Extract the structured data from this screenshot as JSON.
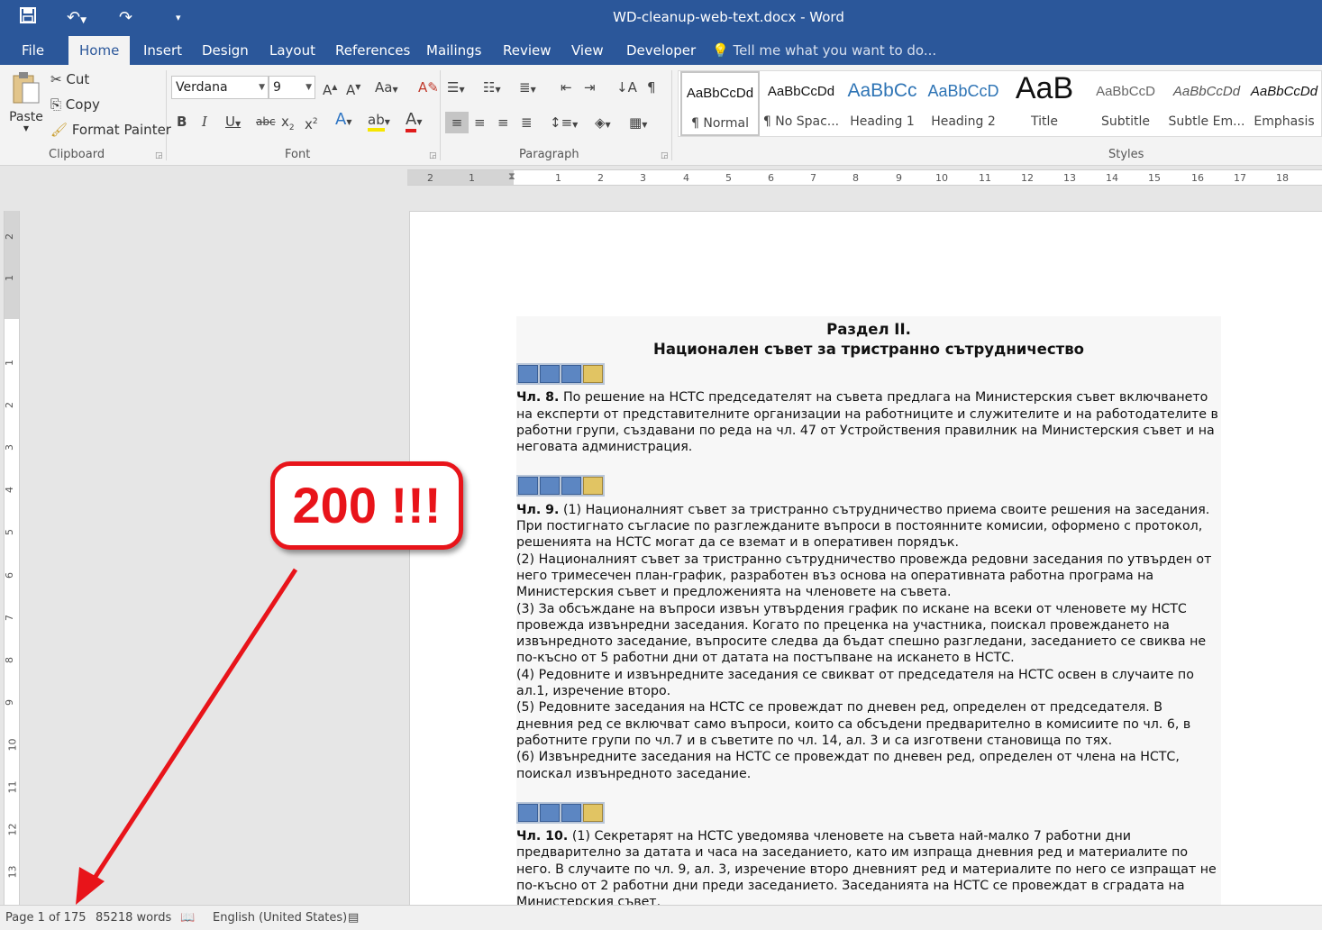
{
  "window": {
    "title": "WD-cleanup-web-text.docx - Word"
  },
  "quick_access": {
    "save_icon": "save-icon",
    "undo_icon": "undo-icon",
    "redo_icon": "redo-icon",
    "customize_icon": "customize-qat-icon"
  },
  "tabs": [
    {
      "label": "File"
    },
    {
      "label": "Home"
    },
    {
      "label": "Insert"
    },
    {
      "label": "Design"
    },
    {
      "label": "Layout"
    },
    {
      "label": "References"
    },
    {
      "label": "Mailings"
    },
    {
      "label": "Review"
    },
    {
      "label": "View"
    },
    {
      "label": "Developer"
    }
  ],
  "tell_me": "Tell me what you want to do...",
  "clipboard": {
    "paste": "Paste",
    "cut": "Cut",
    "copy": "Copy",
    "format_painter": "Format Painter",
    "label": "Clipboard"
  },
  "font": {
    "family": "Verdana",
    "size": "9",
    "label": "Font"
  },
  "paragraph": {
    "label": "Paragraph"
  },
  "styles": {
    "label": "Styles",
    "items": [
      {
        "sample": "AaBbCcDd",
        "name": "¶ Normal"
      },
      {
        "sample": "AaBbCcDd",
        "name": "¶ No Spac..."
      },
      {
        "sample": "AaBbCc",
        "name": "Heading 1"
      },
      {
        "sample": "AaBbCcD",
        "name": "Heading 2"
      },
      {
        "sample": "AaB",
        "name": "Title"
      },
      {
        "sample": "AaBbCcD",
        "name": "Subtitle"
      },
      {
        "sample": "AaBbCcDd",
        "name": "Subtle Em..."
      },
      {
        "sample": "AaBbCcDd",
        "name": "Emphasis"
      }
    ]
  },
  "ruler": {
    "h_ticks": [
      "2",
      "1",
      "1",
      "2",
      "3",
      "4",
      "5",
      "6",
      "7",
      "8",
      "9",
      "10",
      "11",
      "12",
      "13",
      "14",
      "15",
      "16",
      "17",
      "18"
    ],
    "v_ticks": [
      "2",
      "1",
      "1",
      "2",
      "3",
      "4",
      "5",
      "6",
      "7",
      "8",
      "9",
      "10",
      "11",
      "12",
      "13"
    ]
  },
  "document": {
    "heading_line1": "Раздел II.",
    "heading_line2": "Национален съвет за тристранно сътрудничество",
    "art8_label": "Чл. 8.",
    "art8_text": " По решение на НСТС председателят на съвета предлага на Министерския съвет включването на експерти от представителните организации на работниците и служителите и на работодателите в работни групи, създавани по реда на чл. 47 от Устройствения правилник на Министерския съвет и на неговата администрация.",
    "art9_label": "Чл. 9.",
    "art9_p1": " (1) Националният съвет за тристранно сътрудничество приема своите решения на заседания. При постигнато съгласие по разглежданите въпроси в постоянните комисии, оформено с протокол, решенията на НСТС могат да се вземат и в оперативен порядък.",
    "art9_p2": "(2) Националният съвет за тристранно сътрудничество провежда редовни заседания по утвърден от него тримесечен план-график, разработен въз основа на оперативната работна програма на Министерския съвет и предложенията на членовете на съвета.",
    "art9_p3": "(3) За обсъждане на въпроси извън утвърдения график по искане на всеки от членовете му НСТС провежда извънредни заседания. Когато по преценка на участника, поискал провеждането на извънредното заседание, въпросите следва да бъдат спешно разгледани, заседанието се свиква не по-късно от 5 работни дни от датата на постъпване на искането в НСТС.",
    "art9_p4": "(4) Редовните и извънредните заседания се свикват от председателя на НСТС освен в случаите по ал.1, изречение второ.",
    "art9_p5": "(5) Редовните заседания на НСТС се провеждат по дневен ред, определен от председателя. В дневния ред се включват само въпроси, които са обсъдени предварително в комисиите по чл. 6, в работните групи по чл.7 и в съветите по чл. 14, ал. 3 и са изготвени становища по тях.",
    "art9_p6": "(6) Извънредните заседания на НСТС се провеждат по дневен ред, определен от члена на НСТС, поискал извънредното заседание.",
    "art10_label": "Чл. 10.",
    "art10_text": " (1) Секретарят на НСТС уведомява членовете на съвета най-малко 7 работни дни предварително за датата и часа на заседанието, като им изпраща дневния ред и материалите по него. В случаите по чл. 9, ал. 3, изречение второ дневният ред и материалите по него се изпращат не по-късно от 2 работни дни преди заседанието. Заседанията на НСТС се провеждат в сградата на Министерския съвет."
  },
  "status": {
    "page": "Page 1 of 175",
    "words": "85218 words",
    "language": "English (United States)"
  },
  "annotation": {
    "text": "200 !!!",
    "color": "#e8141a"
  }
}
